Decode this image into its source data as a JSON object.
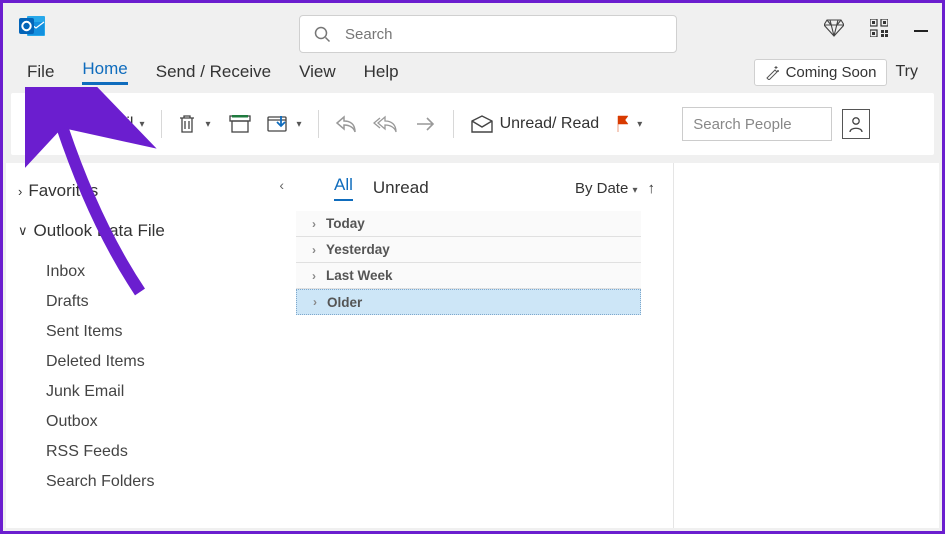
{
  "titlebar": {
    "search_placeholder": "Search"
  },
  "menu": {
    "items": [
      "File",
      "Home",
      "Send / Receive",
      "View",
      "Help"
    ],
    "active_index": 1,
    "coming_soon": "Coming Soon",
    "try": "Try"
  },
  "ribbon": {
    "new_email": "New Email",
    "unread_read": "Unread/ Read",
    "search_people_placeholder": "Search People"
  },
  "sidebar": {
    "favorites_label": "Favorites",
    "data_file_label": "Outlook Data File",
    "folders": [
      "Inbox",
      "Drafts",
      "Sent Items",
      "Deleted Items",
      "Junk Email",
      "Outbox",
      "RSS Feeds",
      "Search Folders"
    ]
  },
  "msglist": {
    "tabs": [
      "All",
      "Unread"
    ],
    "active_tab": 0,
    "sort_label": "By Date",
    "groups": [
      "Today",
      "Yesterday",
      "Last Week",
      "Older"
    ],
    "selected_group_index": 3
  }
}
